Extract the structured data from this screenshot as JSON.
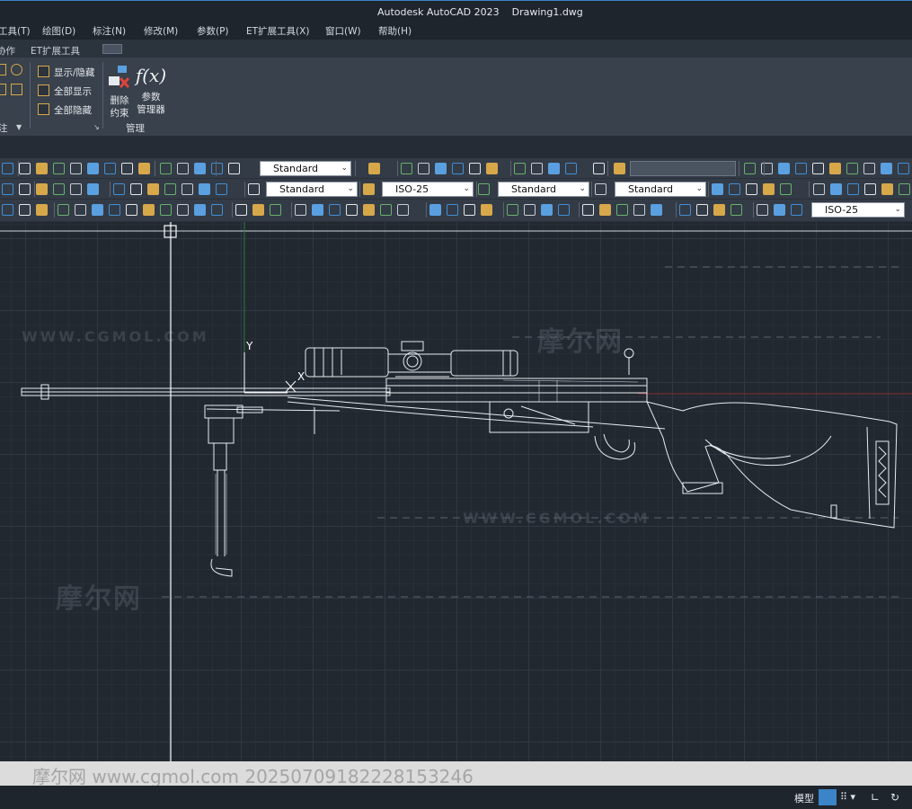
{
  "titlebar": {
    "app": "Autodesk AutoCAD 2023",
    "file": "Drawing1.dwg"
  },
  "menu": [
    "工具(T)",
    "绘图(D)",
    "标注(N)",
    "修改(M)",
    "参数(P)",
    "ET扩展工具(X)",
    "窗口(W)",
    "帮助(H)"
  ],
  "ribbon_tabs": [
    "协作",
    "ET扩展工具"
  ],
  "ribbon": {
    "visibility_items": [
      "显示/隐藏",
      "全部显示",
      "全部隐藏"
    ],
    "annotation_panel_label": "注",
    "delete_constraint": [
      "删除",
      "约束"
    ],
    "param_manager": [
      "参数",
      "管理器"
    ],
    "manage_panel_label": "管理",
    "fx_label": "f(x)"
  },
  "toolbars": {
    "text_style": "Standard",
    "dim_style": "ISO-25",
    "table_style": "Standard",
    "mleader_style": "Standard",
    "row1_style": "Standard",
    "row3_dim_style": "ISO-25"
  },
  "canvas": {
    "ucs_y": "Y",
    "ucs_x": "X",
    "watermark_big": "摩尔网",
    "watermark_url": "WWW.CGMOL.COM"
  },
  "command_line": {
    "text": "摩尔网  www.cgmol.com 20250709182228153246"
  },
  "statusbar": {
    "model_tab": "模型"
  },
  "colors": {
    "title_accent": "#3b84c8",
    "ribbon_bg": "#38414c",
    "canvas_bg": "#212830",
    "drawing_lines": "#e8ecf0"
  }
}
